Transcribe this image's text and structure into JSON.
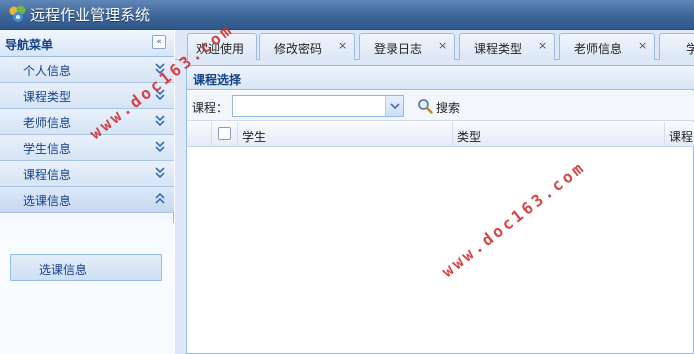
{
  "app": {
    "title": "远程作业管理系统"
  },
  "sidebar": {
    "title": "导航菜单",
    "collapse_glyph": "«",
    "items": [
      {
        "label": "个人信息",
        "expanded": false
      },
      {
        "label": "课程类型",
        "expanded": false
      },
      {
        "label": "老师信息",
        "expanded": false
      },
      {
        "label": "学生信息",
        "expanded": false
      },
      {
        "label": "课程信息",
        "expanded": false
      },
      {
        "label": "选课信息",
        "expanded": true
      }
    ],
    "sub_items": [
      {
        "label": "选课信息"
      }
    ]
  },
  "tabs": [
    {
      "label": "欢迎使用",
      "closable": false
    },
    {
      "label": "修改密码",
      "closable": true
    },
    {
      "label": "登录日志",
      "closable": true
    },
    {
      "label": "课程类型",
      "closable": true
    },
    {
      "label": "老师信息",
      "closable": true
    },
    {
      "label": "学",
      "closable": false
    }
  ],
  "tab_close_glyph": "×",
  "panel": {
    "title": "课程选择",
    "course_label": "课程：",
    "course_value": "",
    "search_label": "搜索",
    "columns": [
      {
        "label": ""
      },
      {
        "label": "学生"
      },
      {
        "label": "类型"
      },
      {
        "label": "课程"
      }
    ]
  },
  "watermark": {
    "text": "www.doc163.com",
    "color": "#cd2828"
  },
  "colors": {
    "accent": "#15428b",
    "border": "#99bbe8",
    "topbar": "#3d6699"
  }
}
